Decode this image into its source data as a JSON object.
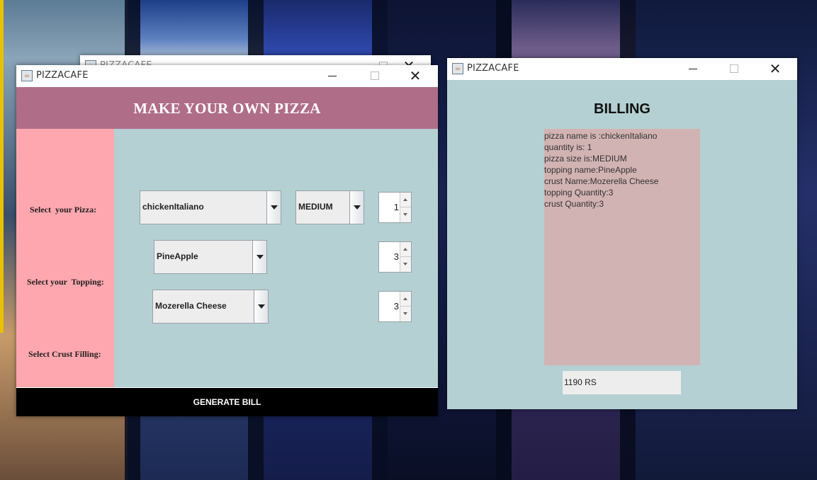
{
  "background_window": {
    "title": "PIZZACAFE"
  },
  "pizza_window": {
    "title": "PIZZACAFE",
    "header": "MAKE YOUR OWN PIZZA",
    "labels": {
      "pizza": "Select  your Pizza:",
      "topping": "Select your  Topping:",
      "crust": "Select Crust Filling:"
    },
    "pizza_select": {
      "selected": "chickenItaliano"
    },
    "size_select": {
      "selected": "MEDIUM"
    },
    "pizza_quantity": "1",
    "topping_select": {
      "selected": "PineApple"
    },
    "topping_quantity": "3",
    "crust_select": {
      "selected": "Mozerella Cheese"
    },
    "crust_quantity": "3",
    "generate_button": "GENERATE BILL",
    "colors": {
      "header": "#b06d88",
      "left_panel": "#ffa7ae",
      "main_panel": "#b4d0d3",
      "button": "#000000"
    }
  },
  "billing_window": {
    "title": "PIZZACAFE",
    "heading": "BILLING",
    "bill_lines": [
      "pizza name is :chickenItaliano",
      "quantity is: 1",
      "pizza size is:MEDIUM",
      "topping name:PineApple",
      "crust Name:Mozerella Cheese",
      "topping Quantity:3",
      "crust Quantity:3"
    ],
    "total": "1190 RS",
    "colors": {
      "body": "#b4d0d3",
      "bill_area": "#d2b3b3"
    }
  },
  "icons": {
    "app": "java-coffee-icon",
    "minimize": "minimize-icon",
    "maximize": "maximize-icon",
    "close": "close-icon",
    "dropdown": "chevron-down-icon",
    "spin_up": "arrow-up-icon",
    "spin_down": "arrow-down-icon"
  }
}
